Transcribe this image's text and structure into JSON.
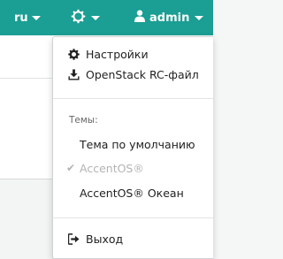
{
  "topbar": {
    "language": "ru",
    "settings_icon": "gear-icon",
    "user_icon": "user-icon",
    "username": "admin"
  },
  "user_menu": {
    "items": [
      {
        "label": "Настройки",
        "icon": "gear-icon"
      },
      {
        "label": "OpenStack RC-файл",
        "icon": "download-icon"
      }
    ],
    "themes_label": "Темы:",
    "themes": [
      {
        "label": "Тема по умолчанию",
        "active": false
      },
      {
        "label": "AccentOS®",
        "active": true
      },
      {
        "label": "AccentOS® Океан",
        "active": false
      }
    ],
    "logout": {
      "label": "Выход",
      "icon": "sign-out-icon"
    }
  },
  "colors": {
    "topbar_bg": "#1b9e93",
    "active_theme": "#b3b3b3"
  }
}
